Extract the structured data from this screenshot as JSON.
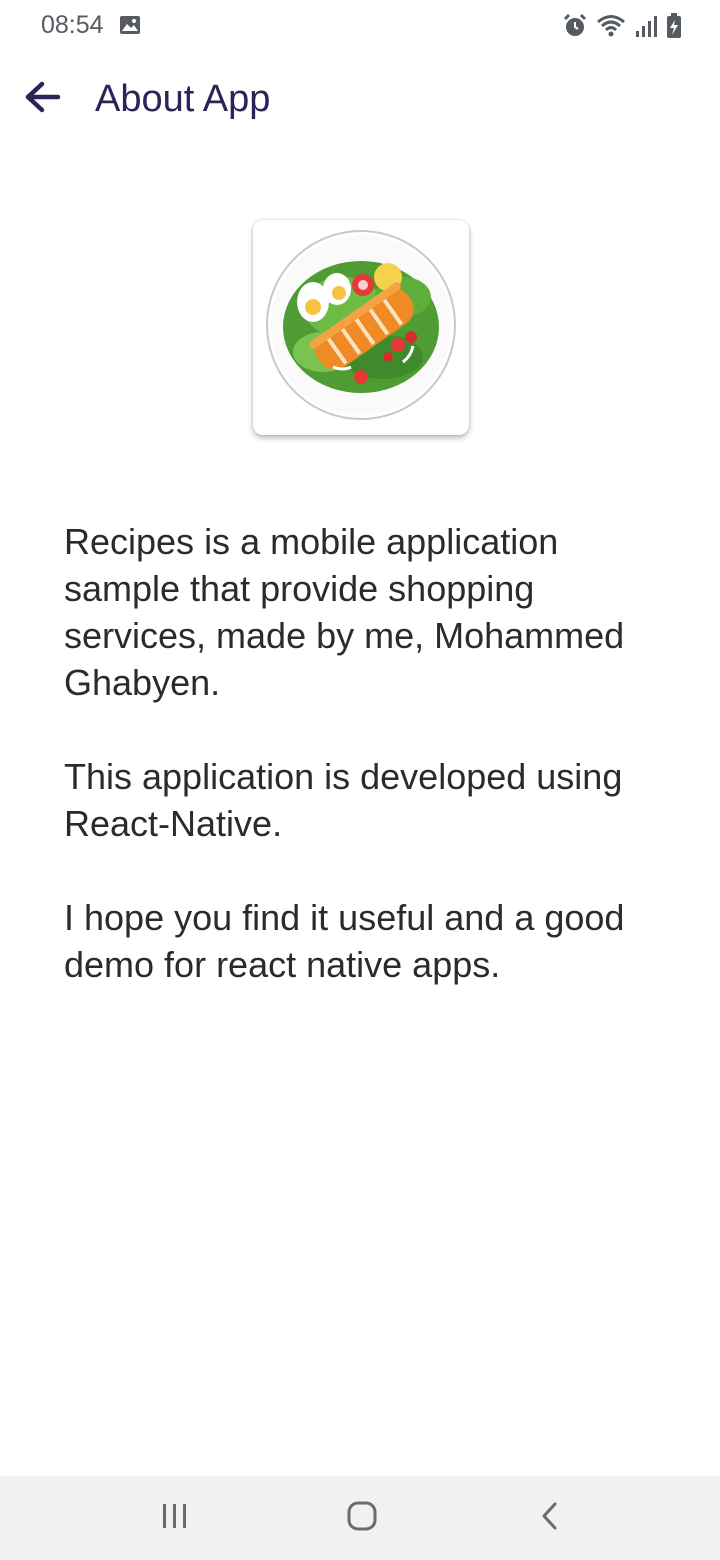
{
  "status_bar": {
    "time": "08:54",
    "icons": [
      "image-icon",
      "alarm-icon",
      "wifi-icon",
      "signal-icon",
      "battery-charging-icon"
    ]
  },
  "app_bar": {
    "title": "About App",
    "back_icon": "arrow-left-icon"
  },
  "logo": {
    "icon": "salad-plate-icon"
  },
  "content": {
    "paragraph_1": "Recipes is a mobile application sample that provide shopping services, made by me, Mohammed Ghabyen.",
    "paragraph_2": "This application is developed using React-Native.",
    "paragraph_3": "I hope you find it useful and a good demo for react native apps."
  },
  "nav_bar": {
    "buttons": [
      "recent-apps-icon",
      "home-icon",
      "back-icon"
    ]
  },
  "colors": {
    "title": "#2a2457",
    "text": "#2b2b2b",
    "nav_background": "#f1f1f1"
  }
}
